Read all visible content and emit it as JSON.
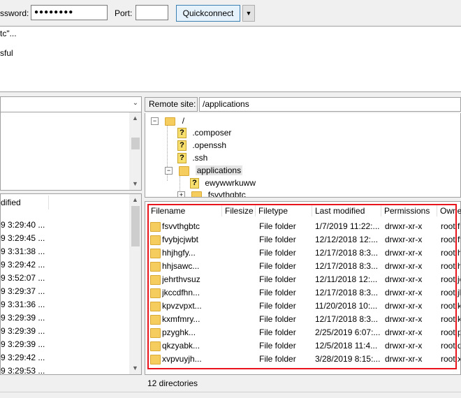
{
  "quickconnect": {
    "password_label": "ssword:",
    "password_value": "●●●●●●●●",
    "port_label": "Port:",
    "port_value": "",
    "button_label": "Quickconnect",
    "dropdown_icon": "chevron-down-icon"
  },
  "log": {
    "lines": [
      "tc\"...",
      "",
      "sful"
    ]
  },
  "local_list": {
    "header": "dified",
    "rows": [
      "9 3:29:40 ...",
      "9 3:29:45 ...",
      "9 3:31:38 ...",
      "9 3:29:42 ...",
      "9 3:52:07 ...",
      "9 3:29:37 ...",
      "9 3:31:36 ...",
      "9 3:29:39 ...",
      "9 3:29:39 ...",
      "9 3:29:39 ...",
      "9 3:29:42 ...",
      "9 3:29:53 ..."
    ]
  },
  "remote": {
    "label": "Remote site:",
    "path": "/applications",
    "tree": {
      "root": "/",
      "items": [
        ".composer",
        ".openssh",
        ".ssh"
      ],
      "applications": "applications",
      "sub_items": [
        "ewywwrkuww",
        "fsvvthgbtc"
      ]
    },
    "columns": [
      "Filename",
      "Filesize",
      "Filetype",
      "Last modified",
      "Permissions",
      "Owne"
    ],
    "files": [
      {
        "name": "fsvvthgbtc",
        "type": "File folder",
        "modified": "1/7/2019 11:22:...",
        "perms": "drwxr-xr-x",
        "owner": "root f"
      },
      {
        "name": "fvybjcjwbt",
        "type": "File folder",
        "modified": "12/12/2018 12:...",
        "perms": "drwxr-xr-x",
        "owner": "root fv"
      },
      {
        "name": "hhjhgfy...",
        "type": "File folder",
        "modified": "12/17/2018 8:3...",
        "perms": "drwxr-xr-x",
        "owner": "root h"
      },
      {
        "name": "hhjsawc...",
        "type": "File folder",
        "modified": "12/17/2018 8:3...",
        "perms": "drwxr-xr-x",
        "owner": "root h"
      },
      {
        "name": "jehrthvsuz",
        "type": "File folder",
        "modified": "12/11/2018 12:...",
        "perms": "drwxr-xr-x",
        "owner": "root je"
      },
      {
        "name": "jkccdfhn...",
        "type": "File folder",
        "modified": "12/17/2018 8:3...",
        "perms": "drwxr-xr-x",
        "owner": "root jk"
      },
      {
        "name": "kpvzvpxt...",
        "type": "File folder",
        "modified": "11/20/2018 10:...",
        "perms": "drwxr-xr-x",
        "owner": "root k"
      },
      {
        "name": "kxmfmry...",
        "type": "File folder",
        "modified": "12/17/2018 8:3...",
        "perms": "drwxr-xr-x",
        "owner": "root k"
      },
      {
        "name": "pzyghk...",
        "type": "File folder",
        "modified": "2/25/2019 6:07:...",
        "perms": "drwxr-xr-x",
        "owner": "root p"
      },
      {
        "name": "qkzyabk...",
        "type": "File folder",
        "modified": "12/5/2018 11:4...",
        "perms": "drwxr-xr-x",
        "owner": "root q"
      },
      {
        "name": "xvpvuyjh...",
        "type": "File folder",
        "modified": "3/28/2019 8:15:...",
        "perms": "drwxr-xr-x",
        "owner": "root x"
      }
    ],
    "status": "12 directories"
  },
  "colors": {
    "highlight_border": "#e8141b",
    "folder": "#f5cd5e",
    "button_bg": "#e5f1fb"
  }
}
